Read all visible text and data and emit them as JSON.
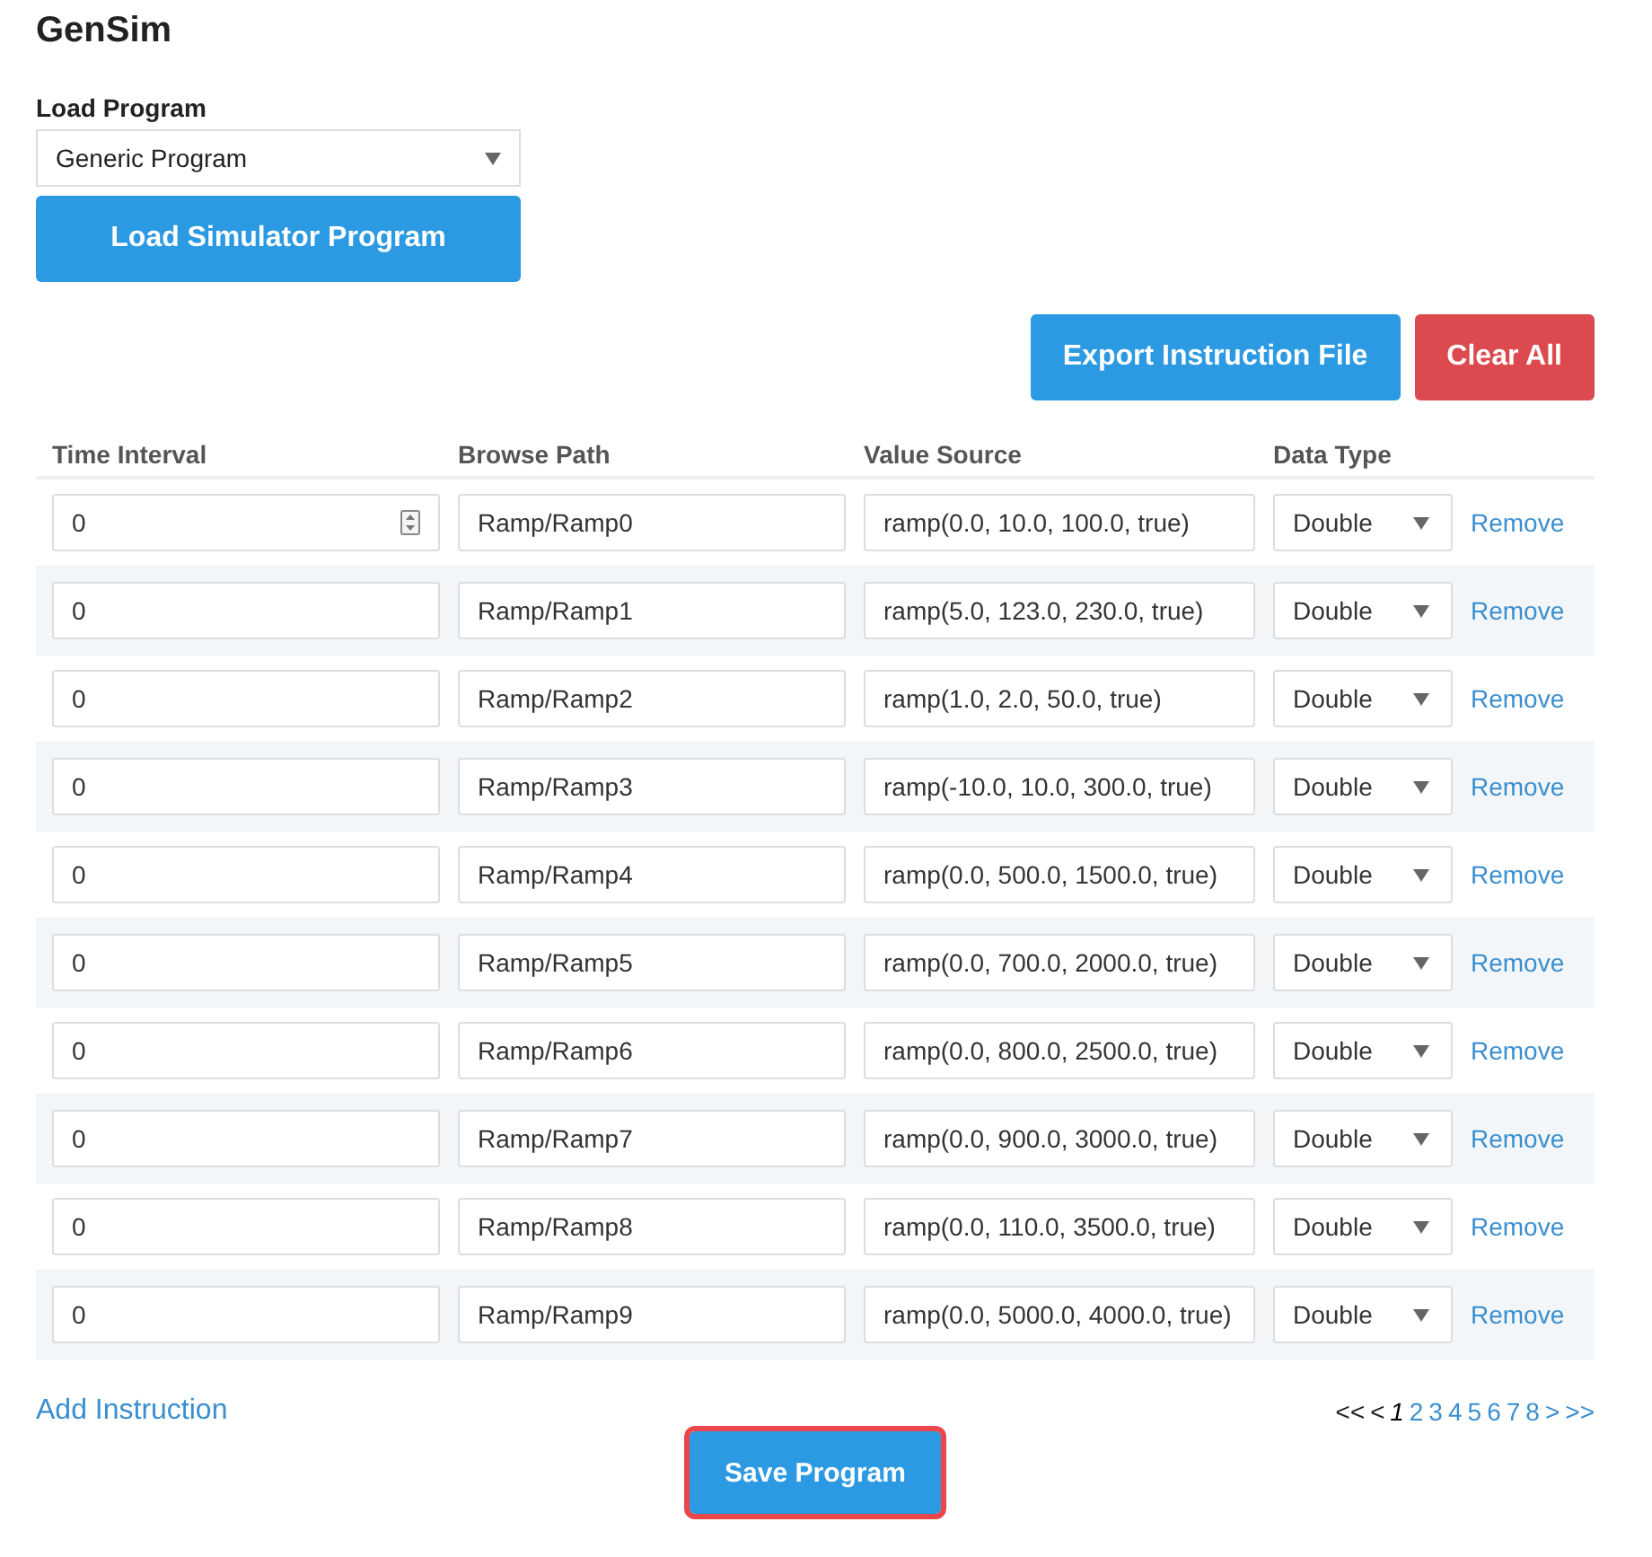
{
  "title": "GenSim",
  "load_program": {
    "label": "Load Program",
    "value": "Generic Program",
    "button": "Load Simulator Program"
  },
  "actions": [
    {
      "label": "Export Instruction File",
      "kind": "primary"
    },
    {
      "label": "Clear All",
      "kind": "danger"
    }
  ],
  "table": {
    "columns": [
      "Time Interval",
      "Browse Path",
      "Value Source",
      "Data Type"
    ],
    "rows": [
      {
        "time_interval": "0",
        "spinner_shown": true,
        "browse_path": "Ramp/Ramp0",
        "value_source": "ramp(0.0, 10.0, 100.0, true)",
        "data_type": "Double",
        "action": "Remove"
      },
      {
        "time_interval": "0",
        "spinner_shown": false,
        "browse_path": "Ramp/Ramp1",
        "value_source": "ramp(5.0, 123.0, 230.0, true)",
        "data_type": "Double",
        "action": "Remove"
      },
      {
        "time_interval": "0",
        "spinner_shown": false,
        "browse_path": "Ramp/Ramp2",
        "value_source": "ramp(1.0, 2.0, 50.0, true)",
        "data_type": "Double",
        "action": "Remove"
      },
      {
        "time_interval": "0",
        "spinner_shown": false,
        "browse_path": "Ramp/Ramp3",
        "value_source": "ramp(-10.0, 10.0, 300.0, true)",
        "data_type": "Double",
        "action": "Remove"
      },
      {
        "time_interval": "0",
        "spinner_shown": false,
        "browse_path": "Ramp/Ramp4",
        "value_source": "ramp(0.0, 500.0, 1500.0, true)",
        "data_type": "Double",
        "action": "Remove"
      },
      {
        "time_interval": "0",
        "spinner_shown": false,
        "browse_path": "Ramp/Ramp5",
        "value_source": "ramp(0.0, 700.0, 2000.0, true)",
        "data_type": "Double",
        "action": "Remove"
      },
      {
        "time_interval": "0",
        "spinner_shown": false,
        "browse_path": "Ramp/Ramp6",
        "value_source": "ramp(0.0, 800.0, 2500.0, true)",
        "data_type": "Double",
        "action": "Remove"
      },
      {
        "time_interval": "0",
        "spinner_shown": false,
        "browse_path": "Ramp/Ramp7",
        "value_source": "ramp(0.0, 900.0, 3000.0, true)",
        "data_type": "Double",
        "action": "Remove"
      },
      {
        "time_interval": "0",
        "spinner_shown": false,
        "browse_path": "Ramp/Ramp8",
        "value_source": "ramp(0.0, 110.0, 3500.0, true)",
        "data_type": "Double",
        "action": "Remove"
      },
      {
        "time_interval": "0",
        "spinner_shown": false,
        "browse_path": "Ramp/Ramp9",
        "value_source": "ramp(0.0, 5000.0, 4000.0, true)",
        "data_type": "Double",
        "action": "Remove"
      }
    ]
  },
  "add_instruction": "Add Instruction",
  "pagination": [
    {
      "label": "<<",
      "disabled": true,
      "selected": false
    },
    {
      "label": "<",
      "disabled": true,
      "selected": false
    },
    {
      "label": "1",
      "disabled": false,
      "selected": true
    },
    {
      "label": "2",
      "disabled": false,
      "selected": false
    },
    {
      "label": "3",
      "disabled": false,
      "selected": false
    },
    {
      "label": "4",
      "disabled": false,
      "selected": false
    },
    {
      "label": "5",
      "disabled": false,
      "selected": false
    },
    {
      "label": "6",
      "disabled": false,
      "selected": false
    },
    {
      "label": "7",
      "disabled": false,
      "selected": false
    },
    {
      "label": "8",
      "disabled": false,
      "selected": false
    },
    {
      "label": ">",
      "disabled": false,
      "selected": false
    },
    {
      "label": ">>",
      "disabled": false,
      "selected": false
    }
  ],
  "save_button": {
    "label": "Save Program",
    "highlighted": true
  }
}
